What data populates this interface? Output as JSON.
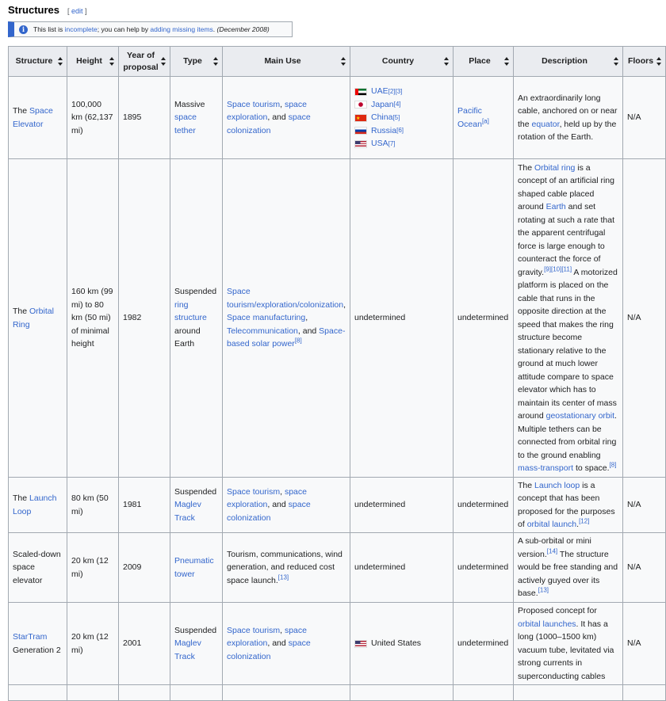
{
  "section": {
    "title": "Structures",
    "edit_open": "[ ",
    "edit_label": "edit",
    "edit_close": " ]"
  },
  "notice": {
    "icon": "info-icon",
    "part1": "This list is ",
    "link1": "incomplete",
    "part2": "; you can help by ",
    "link2": "adding missing items",
    "part3": ". ",
    "date": "(December 2008)"
  },
  "table": {
    "headers": {
      "structure": "Structure",
      "height": "Height",
      "year": "Year of proposal",
      "type": "Type",
      "main_use": "Main Use",
      "country": "Country",
      "place": "Place",
      "description": "Description",
      "floors": "Floors"
    },
    "rows": [
      {
        "structure_pre": "The ",
        "structure_link": "Space Elevator",
        "height": "100,000 km (62,137 mi)",
        "year": "1895",
        "type_pre": "Massive ",
        "type_link": "space tether",
        "use_link1": "Space tourism",
        "use_sep1": ", ",
        "use_link2": "space exploration",
        "use_sep2": ", and ",
        "use_link3": "space colonization",
        "countries": [
          {
            "flag": "flag-uae",
            "name": "UAE",
            "ref": "[2][3]"
          },
          {
            "flag": "flag-japan",
            "name": "Japan",
            "ref": "[4]"
          },
          {
            "flag": "flag-china",
            "name": "China",
            "ref": "[5]"
          },
          {
            "flag": "flag-russia",
            "name": "Russia",
            "ref": " [6]"
          },
          {
            "flag": "flag-usa",
            "name": "USA",
            "ref": " [7]"
          }
        ],
        "place_link": "Pacific Ocean",
        "place_ref": "[a]",
        "desc1": "An extraordinarily long cable, anchored on or near the ",
        "desc_link1": "equator",
        "desc2": ", held up by the rotation of the Earth.",
        "floors": "N/A"
      },
      {
        "structure_pre": "The ",
        "structure_link": "Orbital Ring",
        "height": "160 km (99 mi) to 80 km (50 mi) of minimal height",
        "year": "1982",
        "type_pre": "Suspended ",
        "type_link": "ring structure",
        "type_post": " around Earth",
        "use_link1": "Space tourism/exploration/colonization",
        "use_sep1": ", ",
        "use_link2": "Space manufacturing",
        "use_sep2": ", ",
        "use_link3": "Telecommunication",
        "use_sep3": ", and ",
        "use_link4": "Space-based solar power",
        "use_ref": "[8]",
        "country": "undetermined",
        "place": "undetermined",
        "desc1": "The ",
        "desc_link1": "Orbital ring",
        "desc2": " is a concept of an artificial ring shaped cable placed around ",
        "desc_link2": "Earth",
        "desc3": " and set rotating at such a rate that the apparent centrifugal force is large enough to counteract the force of gravity.",
        "desc_ref1": "[9][10][11]",
        "desc4": " A motorized platform is placed on the cable that runs in the opposite direction at the speed that makes the ring structure become stationary relative to the ground at much lower attitude compare to space elevator which has to maintain its center of mass around ",
        "desc_link3": "geostationary orbit",
        "desc5": ". Multiple tethers can be connected from orbital ring to the ground enabling ",
        "desc_link4": "mass-transport",
        "desc6": " to space.",
        "desc_ref2": "[8]",
        "floors": "N/A"
      },
      {
        "structure_pre": "The ",
        "structure_link": "Launch Loop",
        "height": "80 km (50 mi)",
        "year": "1981",
        "type_pre": "Suspended ",
        "type_link": "Maglev Track",
        "use_link1": "Space tourism",
        "use_sep1": ", ",
        "use_link2": "space exploration",
        "use_sep2": ", and ",
        "use_link3": "space colonization",
        "country": "undetermined",
        "place": "undetermined",
        "desc1": "The ",
        "desc_link1": "Launch loop",
        "desc2": " is a concept that has been proposed for the purposes of ",
        "desc_link2": "orbital launch",
        "desc3": ".",
        "desc_ref1": "[12]",
        "floors": "N/A"
      },
      {
        "structure": "Scaled-down space elevator",
        "height": "20 km (12 mi)",
        "year": "2009",
        "type_link": "Pneumatic tower",
        "use": "Tourism, communications, wind generation, and reduced cost space launch.",
        "use_ref": "[13]",
        "country": "undetermined",
        "place": "undetermined",
        "desc1": "A sub-orbital or mini version.",
        "desc_ref1": "[14]",
        "desc2": " The structure would be free standing and actively guyed over its base.",
        "desc_ref2": "[13]",
        "floors": "N/A"
      },
      {
        "structure_link": "StarTram",
        "structure_post": " Generation 2",
        "height": "20 km (12 mi)",
        "year": "2001",
        "type_pre": "Suspended ",
        "type_link": "Maglev Track",
        "use_link1": "Space tourism",
        "use_sep1": ", ",
        "use_link2": "space exploration",
        "use_sep2": ", and ",
        "use_link3": "space colonization",
        "country_flag": "flag-usa",
        "country": "United States",
        "place": "undetermined",
        "desc1": "Proposed concept for ",
        "desc_link1": "orbital launches",
        "desc2": ". It has a long (1000–1500 km) vacuum tube, levitated via strong currents in superconducting cables",
        "floors": "N/A"
      }
    ]
  }
}
